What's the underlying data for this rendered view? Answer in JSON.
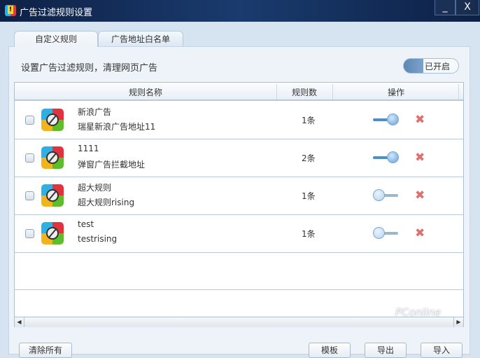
{
  "window": {
    "title": "广告过滤规则设置",
    "minimize": "_",
    "close": "X"
  },
  "tabs": [
    {
      "label": "自定义规则",
      "active": true
    },
    {
      "label": "广告地址白名单",
      "active": false
    }
  ],
  "description": "设置广告过滤规则，清理网页广告",
  "master_toggle": {
    "label": "已开启",
    "on": true
  },
  "table": {
    "headers": [
      "规则名称",
      "规则数",
      "操作"
    ],
    "rows": [
      {
        "name": "新浪广告",
        "desc": "瑞星新浪广告地址11",
        "count": "1条",
        "enabled": true
      },
      {
        "name": "1111",
        "desc": "弹窗广告拦截地址",
        "count": "2条",
        "enabled": true
      },
      {
        "name": "超大规则",
        "desc": "超大规则rising",
        "count": "1条",
        "enabled": false
      },
      {
        "name": "test",
        "desc": "testrising",
        "count": "1条",
        "enabled": false
      }
    ]
  },
  "buttons": {
    "clear_all": "清除所有",
    "template": "模板",
    "export": "导出",
    "import": "导入"
  },
  "watermark": "PConline"
}
